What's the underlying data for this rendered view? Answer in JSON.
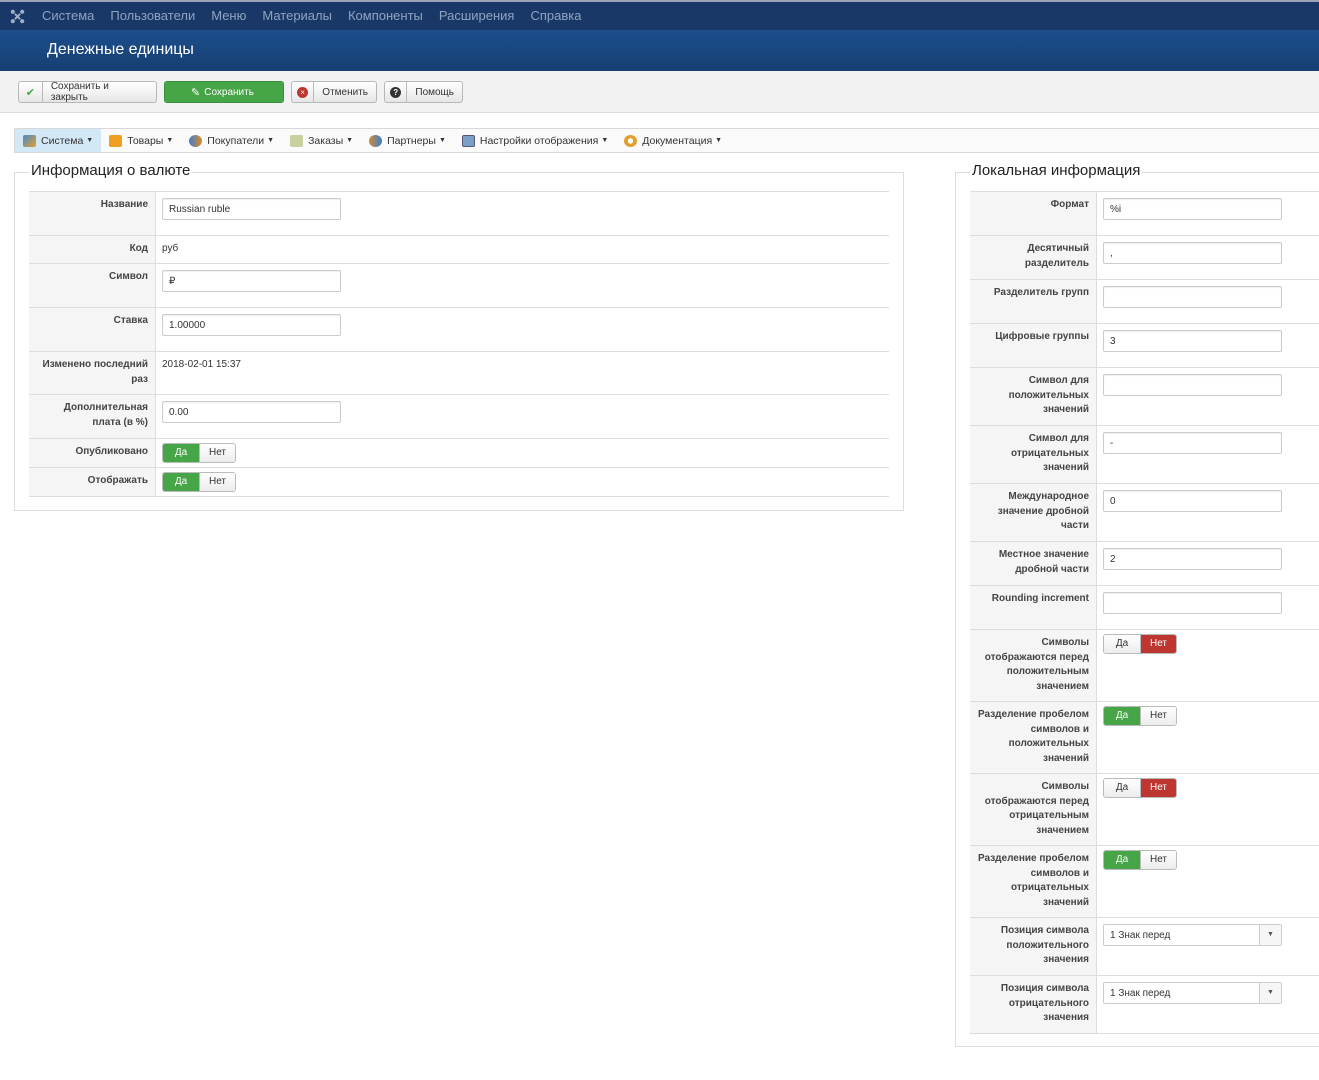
{
  "topnav": {
    "items": [
      "Система",
      "Пользователи",
      "Меню",
      "Материалы",
      "Компоненты",
      "Расширения",
      "Справка"
    ]
  },
  "header": {
    "title": "Денежные единицы"
  },
  "toolbar": {
    "save_close": "Сохранить и закрыть",
    "save": "Сохранить",
    "cancel": "Отменить",
    "help": "Помощь"
  },
  "submenu": {
    "items": [
      "Система",
      "Товары",
      "Покупатели",
      "Заказы",
      "Партнеры",
      "Настройки отображения",
      "Документация"
    ]
  },
  "currency_info": {
    "legend": "Информация о валюте",
    "name_label": "Название",
    "name_value": "Russian ruble",
    "code_label": "Код",
    "code_value": "руб",
    "symbol_label": "Символ",
    "symbol_value": "₽",
    "rate_label": "Ставка",
    "rate_value": "1.00000",
    "modified_label": "Изменено последний раз",
    "modified_value": "2018-02-01 15:37",
    "extra_fee_label": "Дополнительная плата (в %)",
    "extra_fee_value": "0.00",
    "published_label": "Опубликовано",
    "display_label": "Отображать",
    "yes": "Да",
    "no": "Нет"
  },
  "local_info": {
    "legend": "Локальная информация",
    "format_label": "Формат",
    "format_value": "%i",
    "decimal_sep_label": "Десятичный разделитель",
    "decimal_sep_value": ",",
    "group_sep_label": "Разделитель групп",
    "group_sep_value": "",
    "digit_groups_label": "Цифровые группы",
    "digit_groups_value": "3",
    "pos_symbol_label": "Символ для положительных значений",
    "pos_symbol_value": "",
    "neg_symbol_label": "Символ для отрицательных значений",
    "neg_symbol_value": "-",
    "intl_frac_label": "Международное значение дробной части",
    "intl_frac_value": "0",
    "local_frac_label": "Местное значение дробной части",
    "local_frac_value": "2",
    "rounding_label": "Rounding increment",
    "rounding_value": "",
    "sym_before_pos_label": "Символы отображаются перед положительным значением",
    "space_pos_label": "Разделение пробелом символов и положительных значений",
    "sym_before_neg_label": "Символы отображаются перед отрицательным значением",
    "space_neg_label": "Разделение пробелом символов и отрицательных значений",
    "pos_position_label": "Позиция символа положительного значения",
    "pos_position_value": "1 Знак перед",
    "neg_position_label": "Позиция символа отрицательного значения",
    "neg_position_value": "1 Знак перед",
    "yes": "Да",
    "no": "Нет"
  },
  "colors": {
    "nav": "#1a3867",
    "header": "#1c4e8c",
    "green": "#46a546",
    "red": "#bd362f"
  }
}
